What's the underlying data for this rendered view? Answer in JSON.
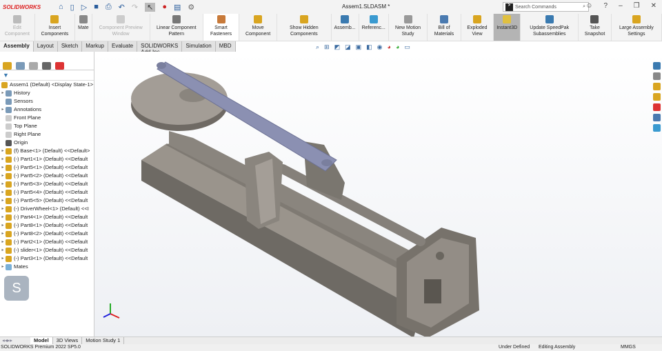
{
  "app": {
    "logo": "SOLIDWORKS",
    "title": "Assem1.SLDASM *",
    "search_placeholder": "Search Commands"
  },
  "ribbon": [
    {
      "label": "Edit Component",
      "disabled": true,
      "color": "#bbb"
    },
    {
      "label": "Insert Components",
      "color": "#d9a520"
    },
    {
      "label": "Mate",
      "color": "#888"
    },
    {
      "label": "Component Preview Window",
      "disabled": true,
      "color": "#ccc"
    },
    {
      "label": "Linear Component Pattern",
      "color": "#777"
    },
    {
      "label": "Smart Fasteners",
      "color": "#c87a3a",
      "selected": true
    },
    {
      "label": "Move Component",
      "color": "#d9a520"
    },
    {
      "label": "Show Hidden Components",
      "color": "#d9a520"
    },
    {
      "label": "Assemb...",
      "color": "#3a7ab0"
    },
    {
      "label": "Referenc...",
      "color": "#3a9ad0"
    },
    {
      "label": "New Motion Study",
      "color": "#999"
    },
    {
      "label": "Bill of Materials",
      "color": "#4a7ab0"
    },
    {
      "label": "Exploded View",
      "color": "#d9a520"
    },
    {
      "label": "Instant3D",
      "color": "#e0c040",
      "active": true
    },
    {
      "label": "Update SpeedPak Subassemblies",
      "color": "#3a7ab0"
    },
    {
      "label": "Take Snapshot",
      "color": "#555"
    },
    {
      "label": "Large Assembly Settings",
      "color": "#d9a520"
    }
  ],
  "tabs": [
    "Assembly",
    "Layout",
    "Sketch",
    "Markup",
    "Evaluate",
    "SOLIDWORKS Add-Ins",
    "Simulation",
    "MBD"
  ],
  "tree": {
    "root": "Assem1 (Default) <Display State-1>",
    "items": [
      {
        "label": "History",
        "arrow": true,
        "color": "#7a9ab8"
      },
      {
        "label": "Sensors",
        "arrow": false,
        "color": "#7a9ab8"
      },
      {
        "label": "Annotations",
        "arrow": true,
        "color": "#7a9ab8"
      },
      {
        "label": "Front Plane",
        "arrow": false,
        "color": "#ccc"
      },
      {
        "label": "Top Plane",
        "arrow": false,
        "color": "#ccc"
      },
      {
        "label": "Right Plane",
        "arrow": false,
        "color": "#ccc"
      },
      {
        "label": "Origin",
        "arrow": false,
        "color": "#555"
      },
      {
        "label": "(f) Base<1> (Default) <<Default>",
        "arrow": true,
        "color": "#d9a520"
      },
      {
        "label": "(-) Part1<1> (Default) <<Default",
        "arrow": true,
        "color": "#d9a520"
      },
      {
        "label": "(-) Part5<1> (Default) <<Default",
        "arrow": true,
        "color": "#d9a520"
      },
      {
        "label": "(-) Part5<2> (Default) <<Default",
        "arrow": true,
        "color": "#d9a520"
      },
      {
        "label": "(-) Part5<3> (Default) <<Default",
        "arrow": true,
        "color": "#d9a520"
      },
      {
        "label": "(-) Part5<4> (Default) <<Default",
        "arrow": true,
        "color": "#d9a520"
      },
      {
        "label": "(-) Part5<5> (Default) <<Default",
        "arrow": true,
        "color": "#d9a520"
      },
      {
        "label": "(-) DriverWheel<1> (Default) <<I",
        "arrow": true,
        "color": "#d9a520"
      },
      {
        "label": "(-) Part4<1> (Default) <<Default",
        "arrow": true,
        "color": "#d9a520"
      },
      {
        "label": "(-) Part8<1> (Default) <<Default",
        "arrow": true,
        "color": "#d9a520"
      },
      {
        "label": "(-) Part8<2> (Default) <<Default",
        "arrow": true,
        "color": "#d9a520"
      },
      {
        "label": "(-) Part2<1> (Default) <<Default",
        "arrow": true,
        "color": "#d9a520"
      },
      {
        "label": "(-) slider<1> (Default) <<Default",
        "arrow": true,
        "color": "#d9a520"
      },
      {
        "label": "(-) Part3<1> (Default) <<Default",
        "arrow": true,
        "color": "#d9a520"
      },
      {
        "label": "Mates",
        "arrow": true,
        "color": "#7ab0d8"
      }
    ]
  },
  "bottom_tabs": [
    "Model",
    "3D Views",
    "Motion Study 1"
  ],
  "status": {
    "left": "SOLIDWORKS Premium 2022 SP5.0",
    "state": "Under Defined",
    "mode": "Editing Assembly",
    "units": "MMGS"
  }
}
